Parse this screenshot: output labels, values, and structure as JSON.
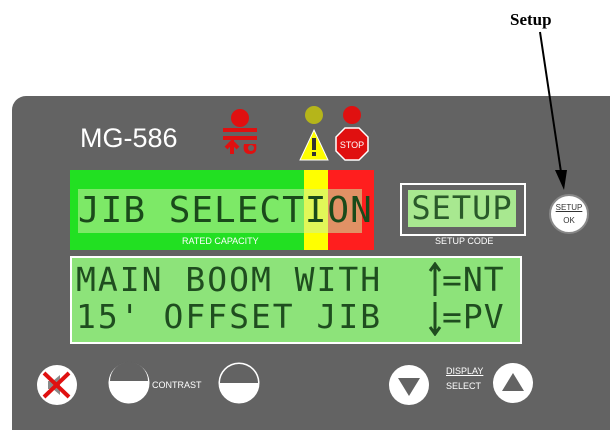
{
  "callout": {
    "label": "Setup"
  },
  "panel": {
    "model": "MG-586",
    "indicators": {
      "stop_label": "STOP"
    },
    "capacity_display": {
      "text": "JIB SELECTION",
      "caption": "RATED CAPACITY"
    },
    "setup_display": {
      "text": "SETUP",
      "caption": "SETUP CODE"
    },
    "main_display": {
      "line1": "MAIN BOOM WITH",
      "line2": "15' OFFSET JIB",
      "hint1": "=NT",
      "hint2": "=PV"
    },
    "setup_button": {
      "line1": "SETUP",
      "line2": "OK"
    },
    "contrast_label": "CONTRAST",
    "display_select": {
      "line1": "DISPLAY",
      "line2": "SELECT"
    }
  },
  "colors": {
    "panel_bg": "#636363",
    "lcd_green": "#22e022",
    "warn_yellow": "#ffff00",
    "alarm_red": "#ff1e1e",
    "lcd_text": "#1f4d1f"
  }
}
